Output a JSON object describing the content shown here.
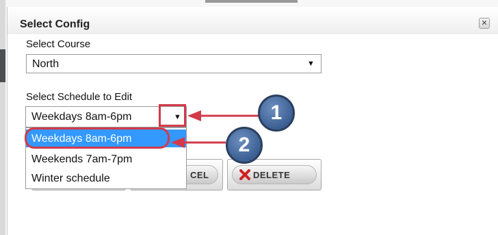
{
  "dialog": {
    "title": "Select Config",
    "close_icon": "✕"
  },
  "course": {
    "label": "Select Course",
    "value": "North"
  },
  "schedule": {
    "label": "Select Schedule to Edit",
    "value": "Weekdays 8am-6pm",
    "options": [
      "Weekdays 8am-6pm",
      "Weekends 7am-7pm",
      "Winter schedule"
    ],
    "selected_option": "Weekdays 8am-6pm"
  },
  "buttons": {
    "cancel_fragment": "CEL",
    "delete_label": "DELETE"
  },
  "annotations": {
    "callout_1": "1",
    "callout_2": "2",
    "highlight_color": "#d23a4a",
    "callout_color": "#3c5f93"
  },
  "icons": {
    "dropdown_arrow": "▼",
    "delete_icon": "red-x-icon"
  }
}
